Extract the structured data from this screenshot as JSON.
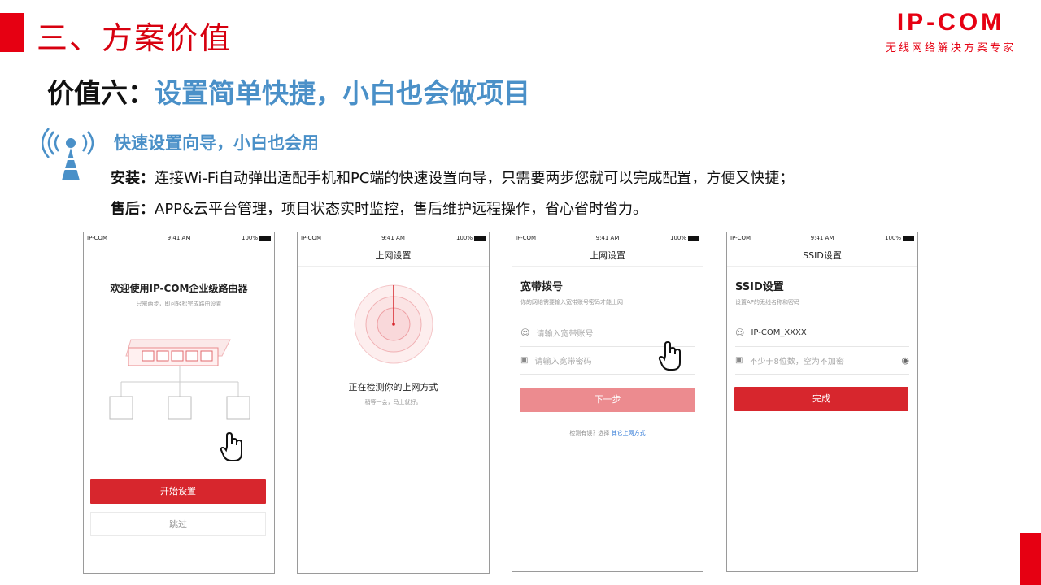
{
  "header": {
    "section_title": "三、方案价值",
    "logo_text": "IP-COM",
    "logo_tagline": "无线网络解决方案专家",
    "brand_color": "#e60012"
  },
  "headline": {
    "prefix": "价值六：",
    "main": "设置简单快捷，小白也会做项目"
  },
  "feature": {
    "icon": "antenna-icon",
    "title": "快速设置向导，小白也会用",
    "install_label": "安装：",
    "install_text": "连接Wi-Fi自动弹出适配手机和PC端的快速设置向导，只需要两步您就可以完成配置，方便又快捷；",
    "after_label": "售后：",
    "after_text": "APP&云平台管理，项目状态实时监控，售后维护远程操作，省心省时省力。"
  },
  "status_bar": {
    "carrier": "IP-COM",
    "time": "9:41 AM",
    "battery": "100%"
  },
  "phone1": {
    "title": "欢迎使用IP-COM企业级路由器",
    "subtitle": "只需两步，即可轻松完成路由设置",
    "primary_button": "开始设置",
    "secondary_button": "跳过"
  },
  "phone2": {
    "nav_title": "上网设置",
    "status": "正在检测你的上网方式",
    "status_sub": "稍等一会，马上就好。"
  },
  "phone3": {
    "nav_title": "上网设置",
    "title": "宽带拨号",
    "subtitle": "你的网络需要输入宽带账号密码才能上网",
    "account_placeholder": "请输入宽带账号",
    "password_placeholder": "请输入宽带密码",
    "next_button": "下一步",
    "hint_prefix": "检测有误？选择",
    "hint_link": "其它上网方式"
  },
  "phone4": {
    "nav_title": "SSID设置",
    "title": "SSID设置",
    "subtitle": "设置AP的无线名称和密码",
    "ssid_value": "IP-COM_XXXX",
    "password_placeholder": "不少于8位数，空为不加密",
    "done_button": "完成"
  }
}
